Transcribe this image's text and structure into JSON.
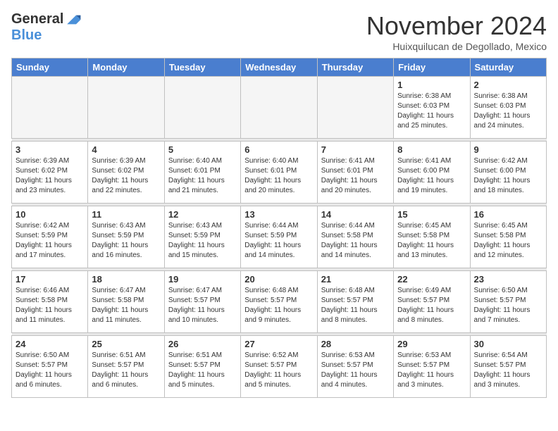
{
  "logo": {
    "general": "General",
    "blue": "Blue"
  },
  "header": {
    "month": "November 2024",
    "location": "Huixquilucan de Degollado, Mexico"
  },
  "weekdays": [
    "Sunday",
    "Monday",
    "Tuesday",
    "Wednesday",
    "Thursday",
    "Friday",
    "Saturday"
  ],
  "weeks": [
    [
      {
        "day": "",
        "info": ""
      },
      {
        "day": "",
        "info": ""
      },
      {
        "day": "",
        "info": ""
      },
      {
        "day": "",
        "info": ""
      },
      {
        "day": "",
        "info": ""
      },
      {
        "day": "1",
        "info": "Sunrise: 6:38 AM\nSunset: 6:03 PM\nDaylight: 11 hours\nand 25 minutes."
      },
      {
        "day": "2",
        "info": "Sunrise: 6:38 AM\nSunset: 6:03 PM\nDaylight: 11 hours\nand 24 minutes."
      }
    ],
    [
      {
        "day": "3",
        "info": "Sunrise: 6:39 AM\nSunset: 6:02 PM\nDaylight: 11 hours\nand 23 minutes."
      },
      {
        "day": "4",
        "info": "Sunrise: 6:39 AM\nSunset: 6:02 PM\nDaylight: 11 hours\nand 22 minutes."
      },
      {
        "day": "5",
        "info": "Sunrise: 6:40 AM\nSunset: 6:01 PM\nDaylight: 11 hours\nand 21 minutes."
      },
      {
        "day": "6",
        "info": "Sunrise: 6:40 AM\nSunset: 6:01 PM\nDaylight: 11 hours\nand 20 minutes."
      },
      {
        "day": "7",
        "info": "Sunrise: 6:41 AM\nSunset: 6:01 PM\nDaylight: 11 hours\nand 20 minutes."
      },
      {
        "day": "8",
        "info": "Sunrise: 6:41 AM\nSunset: 6:00 PM\nDaylight: 11 hours\nand 19 minutes."
      },
      {
        "day": "9",
        "info": "Sunrise: 6:42 AM\nSunset: 6:00 PM\nDaylight: 11 hours\nand 18 minutes."
      }
    ],
    [
      {
        "day": "10",
        "info": "Sunrise: 6:42 AM\nSunset: 5:59 PM\nDaylight: 11 hours\nand 17 minutes."
      },
      {
        "day": "11",
        "info": "Sunrise: 6:43 AM\nSunset: 5:59 PM\nDaylight: 11 hours\nand 16 minutes."
      },
      {
        "day": "12",
        "info": "Sunrise: 6:43 AM\nSunset: 5:59 PM\nDaylight: 11 hours\nand 15 minutes."
      },
      {
        "day": "13",
        "info": "Sunrise: 6:44 AM\nSunset: 5:59 PM\nDaylight: 11 hours\nand 14 minutes."
      },
      {
        "day": "14",
        "info": "Sunrise: 6:44 AM\nSunset: 5:58 PM\nDaylight: 11 hours\nand 14 minutes."
      },
      {
        "day": "15",
        "info": "Sunrise: 6:45 AM\nSunset: 5:58 PM\nDaylight: 11 hours\nand 13 minutes."
      },
      {
        "day": "16",
        "info": "Sunrise: 6:45 AM\nSunset: 5:58 PM\nDaylight: 11 hours\nand 12 minutes."
      }
    ],
    [
      {
        "day": "17",
        "info": "Sunrise: 6:46 AM\nSunset: 5:58 PM\nDaylight: 11 hours\nand 11 minutes."
      },
      {
        "day": "18",
        "info": "Sunrise: 6:47 AM\nSunset: 5:58 PM\nDaylight: 11 hours\nand 11 minutes."
      },
      {
        "day": "19",
        "info": "Sunrise: 6:47 AM\nSunset: 5:57 PM\nDaylight: 11 hours\nand 10 minutes."
      },
      {
        "day": "20",
        "info": "Sunrise: 6:48 AM\nSunset: 5:57 PM\nDaylight: 11 hours\nand 9 minutes."
      },
      {
        "day": "21",
        "info": "Sunrise: 6:48 AM\nSunset: 5:57 PM\nDaylight: 11 hours\nand 8 minutes."
      },
      {
        "day": "22",
        "info": "Sunrise: 6:49 AM\nSunset: 5:57 PM\nDaylight: 11 hours\nand 8 minutes."
      },
      {
        "day": "23",
        "info": "Sunrise: 6:50 AM\nSunset: 5:57 PM\nDaylight: 11 hours\nand 7 minutes."
      }
    ],
    [
      {
        "day": "24",
        "info": "Sunrise: 6:50 AM\nSunset: 5:57 PM\nDaylight: 11 hours\nand 6 minutes."
      },
      {
        "day": "25",
        "info": "Sunrise: 6:51 AM\nSunset: 5:57 PM\nDaylight: 11 hours\nand 6 minutes."
      },
      {
        "day": "26",
        "info": "Sunrise: 6:51 AM\nSunset: 5:57 PM\nDaylight: 11 hours\nand 5 minutes."
      },
      {
        "day": "27",
        "info": "Sunrise: 6:52 AM\nSunset: 5:57 PM\nDaylight: 11 hours\nand 5 minutes."
      },
      {
        "day": "28",
        "info": "Sunrise: 6:53 AM\nSunset: 5:57 PM\nDaylight: 11 hours\nand 4 minutes."
      },
      {
        "day": "29",
        "info": "Sunrise: 6:53 AM\nSunset: 5:57 PM\nDaylight: 11 hours\nand 3 minutes."
      },
      {
        "day": "30",
        "info": "Sunrise: 6:54 AM\nSunset: 5:57 PM\nDaylight: 11 hours\nand 3 minutes."
      }
    ]
  ]
}
